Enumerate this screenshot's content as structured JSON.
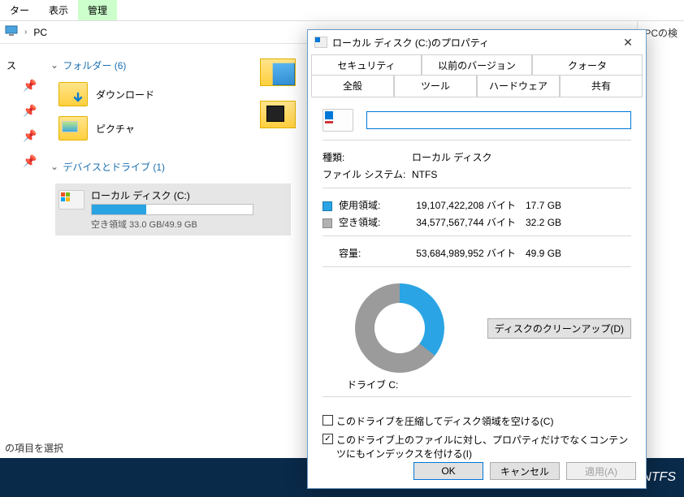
{
  "ribbon": {
    "tab1_suffix": "ター",
    "view": "表示",
    "manage": "管理"
  },
  "addr": {
    "pc": "PC",
    "side": "PCの検"
  },
  "left_suffix": "ス",
  "sections": {
    "folders": "フォルダー (6)",
    "devices": "デバイスとドライブ (1)"
  },
  "folders": {
    "downloads": "ダウンロード",
    "pictures": "ピクチャ"
  },
  "drive": {
    "name": "ローカル ディスク (C:)",
    "bar_pct": 34,
    "free_text": "空き領域 33.0 GB/49.9 GB"
  },
  "status": "の項目を選択",
  "darkstrip": "NTFS",
  "dialog": {
    "title": "ローカル ディスク (C:)のプロパティ",
    "tabs_top": {
      "security": "セキュリティ",
      "prev": "以前のバージョン",
      "quota": "クォータ"
    },
    "tabs_bot": {
      "general": "全般",
      "tools": "ツール",
      "hardware": "ハードウェア",
      "sharing": "共有"
    },
    "name_value": "",
    "rows": {
      "type_k": "種類:",
      "type_v": "ローカル ディスク",
      "fs_k": "ファイル システム:",
      "fs_v": "NTFS",
      "used_k": "使用領域:",
      "used_bytes": "19,107,422,208 バイト",
      "used_h": "17.7 GB",
      "free_k": "空き領域:",
      "free_bytes": "34,577,567,744 バイト",
      "free_h": "32.2 GB",
      "cap_k": "容量:",
      "cap_bytes": "53,684,989,952 バイト",
      "cap_h": "49.9 GB"
    },
    "drive_label": "ドライブ C:",
    "cleanup": "ディスクのクリーンアップ(D)",
    "chk_compress": "このドライブを圧縮してディスク領域を空ける(C)",
    "chk_index": "このドライブ上のファイルに対し、プロパティだけでなくコンテンツにもインデックスを付ける(I)",
    "ok": "OK",
    "cancel": "キャンセル",
    "apply": "適用(A)"
  }
}
